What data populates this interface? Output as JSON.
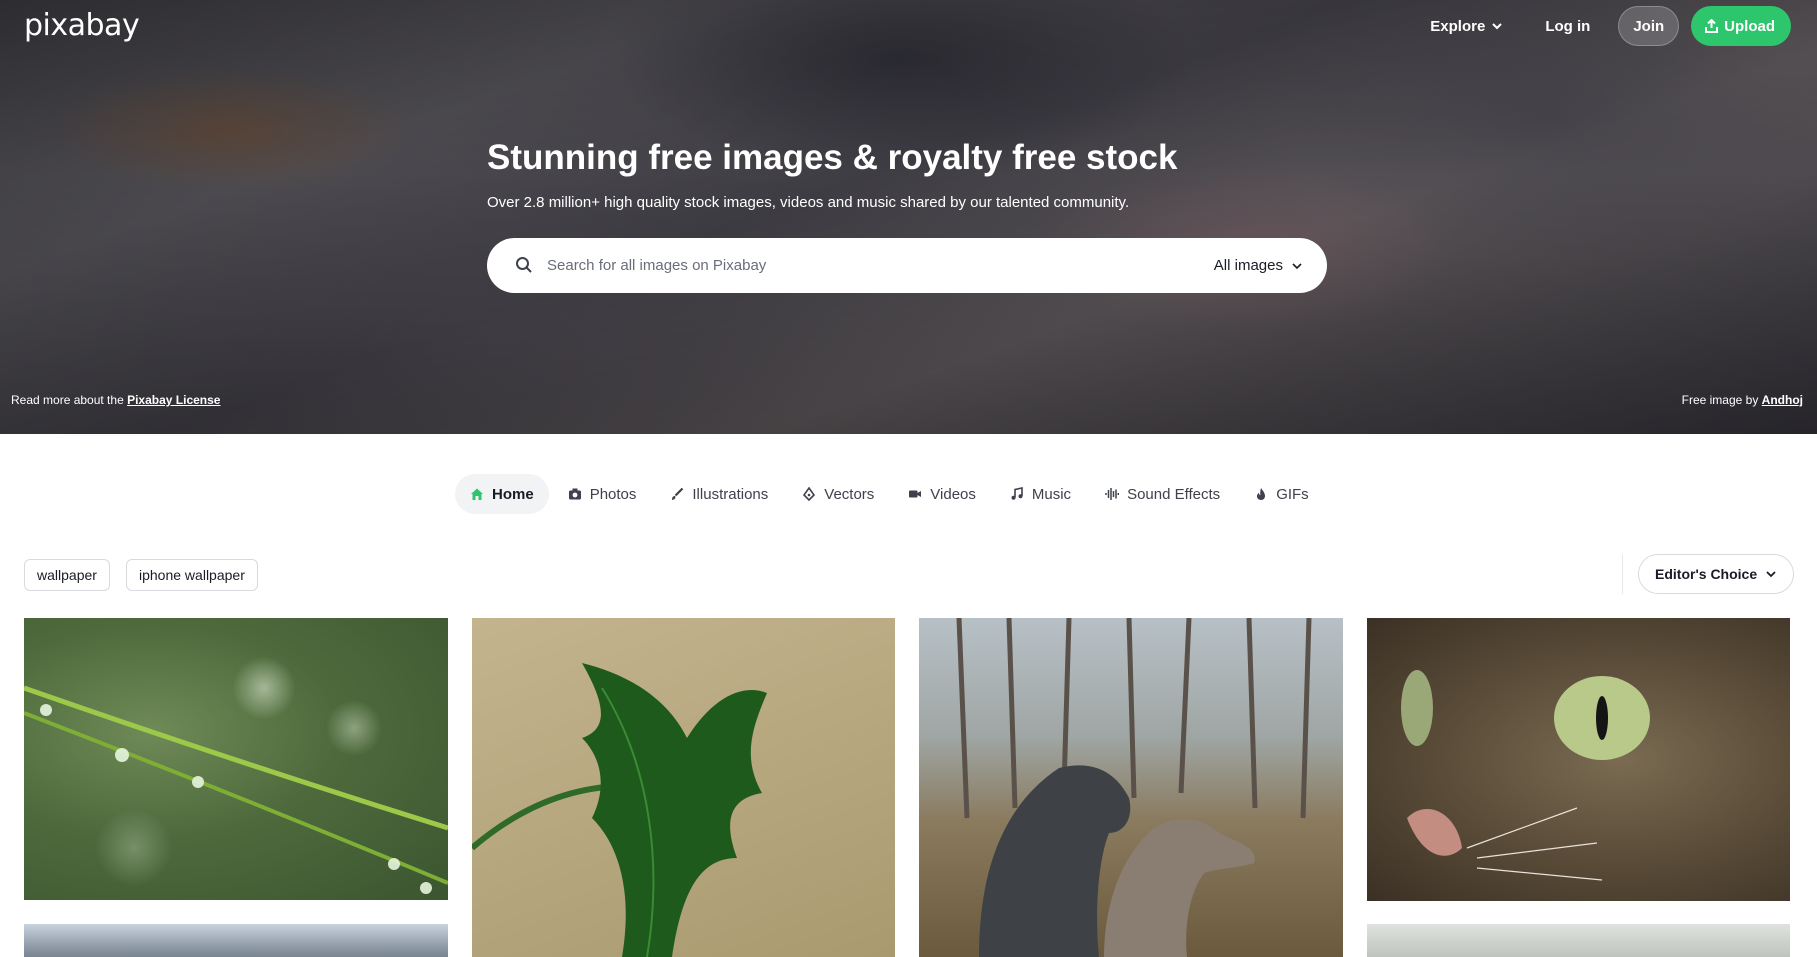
{
  "brand": {
    "logo_text": "pixabay"
  },
  "header": {
    "explore_label": "Explore",
    "login_label": "Log in",
    "join_label": "Join",
    "upload_label": "Upload"
  },
  "hero": {
    "title": "Stunning free images & royalty free stock",
    "subtitle": "Over 2.8 million+ high quality stock images, videos and music shared by our talented community.",
    "search_placeholder": "Search for all images on Pixabay",
    "search_type": "All images",
    "license_prefix": "Read more about the",
    "license_link": "Pixabay License",
    "credit_prefix": "Free image by",
    "credit_author": "Andhoj"
  },
  "tabs": [
    {
      "label": "Home",
      "icon": "home-icon",
      "active": true
    },
    {
      "label": "Photos",
      "icon": "camera-icon"
    },
    {
      "label": "Illustrations",
      "icon": "brush-icon"
    },
    {
      "label": "Vectors",
      "icon": "pen-nib-icon"
    },
    {
      "label": "Videos",
      "icon": "video-camera-icon"
    },
    {
      "label": "Music",
      "icon": "music-note-icon"
    },
    {
      "label": "Sound Effects",
      "icon": "waveform-icon"
    },
    {
      "label": "GIFs",
      "icon": "flame-icon"
    }
  ],
  "tags": [
    "wallpaper",
    "iphone wallpaper"
  ],
  "sort": {
    "label": "Editor's Choice"
  },
  "colors": {
    "accent_green": "#2ec66d",
    "text_dark": "#191b26"
  }
}
